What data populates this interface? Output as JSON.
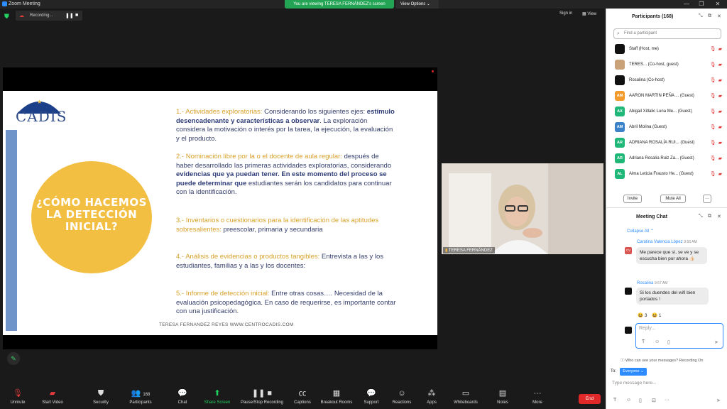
{
  "window": {
    "title": "Zoom Meeting",
    "banner": "You are viewing TERESA FERNÁNDEZ's screen",
    "view_options": "View Options"
  },
  "recording": {
    "label": "Recording..."
  },
  "top_right": {
    "sign_in": "Sign in",
    "view": "View"
  },
  "slide": {
    "logo": "CADIS",
    "circle_text": "¿CÓMO HACEMOS LA DETECCIÓN INICIAL?",
    "items": [
      {
        "title": "1.- Actividades exploratorias:",
        "text": " Considerando los siguientes ejes: ",
        "bold": "estímulo desencadenante y características a observar",
        "rest": ". La exploración considera la motivación o interés por la tarea, la ejecución, la evaluación y el producto."
      },
      {
        "title": "2.- Nominación libre por la o el docente de aula regular:",
        "text": " después de haber desarrollado las primeras actividades exploratorias, considerando ",
        "bold": "evidencias que ya puedan tener. En este momento del proceso se puede determinar que",
        "rest": " estudiantes serán los candidatos para continuar con la identificación."
      },
      {
        "title": "3.- Inventarios o cuestionarios para la identificación de las aptitudes sobresalientes:",
        "text": " preescolar, primaria y secundaria",
        "bold": "",
        "rest": ""
      },
      {
        "title": "4.- Análisis de evidencias o productos tangibles:",
        "text": " Entrevista a las y los estudiantes, familias y a las y los docentes:",
        "bold": "",
        "rest": ""
      },
      {
        "title": "5.- Informe de detección inicial:",
        "text": "  Entre otras cosas…. Necesidad de la evaluación psicopedagógica. En caso de requerirse, es importante contar con una justificación.",
        "bold": "",
        "rest": ""
      }
    ],
    "footer": "TERESA FERNANDEZ REYES   WWW.CENTROCADIS.COM"
  },
  "video": {
    "name": "TERESA FERNÁNDEZ"
  },
  "toolbar": {
    "unmute": "Unmute",
    "start_video": "Start Video",
    "security": "Security",
    "participants": "Participants",
    "participants_count": "168",
    "chat": "Chat",
    "share_screen": "Share Screen",
    "recording": "Pause/Stop Recording",
    "captions": "Captions",
    "breakout": "Breakout Rooms",
    "support": "Support",
    "reactions": "Reactions",
    "apps": "Apps",
    "whiteboards": "Whiteboards",
    "notes": "Notes",
    "more": "More",
    "end": "End"
  },
  "participants_panel": {
    "title": "Participants (168)",
    "search_placeholder": "Find a participant",
    "list": [
      {
        "initials": "",
        "name": "Staff (Host, me)",
        "color": "#111111"
      },
      {
        "initials": "",
        "name": "TERES... (Co-host, guest)",
        "color": "#c9a27a"
      },
      {
        "initials": "",
        "name": "Rosalina (Co-host)",
        "color": "#111111"
      },
      {
        "initials": "AM",
        "name": "AARON MARTIN PEÑA ...  (Guest)",
        "color": "#f39c2d"
      },
      {
        "initials": "AX",
        "name": "Abigail Xitlalic Luna Me...  (Guest)",
        "color": "#1fb879"
      },
      {
        "initials": "AM",
        "name": "Abril Molina (Guest)",
        "color": "#3b82c9"
      },
      {
        "initials": "AR",
        "name": "ADRIANA ROSALÍA RUI...  (Guest)",
        "color": "#1fb879"
      },
      {
        "initials": "AR",
        "name": "Adriana Rosalía Ruiz Za...  (Guest)",
        "color": "#1fb879"
      },
      {
        "initials": "AL",
        "name": "Alma Leticia Frausto He...  (Guest)",
        "color": "#1fb879"
      }
    ],
    "invite": "Invite",
    "mute_all": "Mute All",
    "more": "···"
  },
  "chat_panel": {
    "title": "Meeting Chat",
    "collapse": "Collapse All",
    "messages": [
      {
        "sender": "Carolina Valencia López",
        "time": "9:56 AM",
        "initials": "CV",
        "text": "Me parece que sí, se ve y se escucha bien por ahora 👍🏻"
      },
      {
        "sender": "Rosalina",
        "time": "9:57 AM",
        "initials": "",
        "text": "Si los duendes del wifi bien portados !"
      }
    ],
    "reactions": [
      "😆 3",
      "😆 1"
    ],
    "reply_placeholder": "Reply...",
    "who_can_see": "Who can see your messages? Recording On",
    "to_label": "To:",
    "to_value": "Everyone",
    "type_placeholder": "Type message here..."
  }
}
